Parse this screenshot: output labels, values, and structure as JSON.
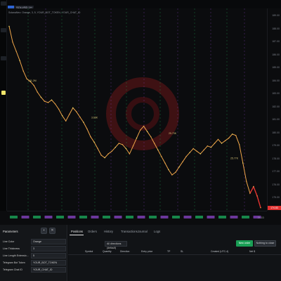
{
  "symbol": {
    "flag": "",
    "ticker": "SOLUSD 1H"
  },
  "indicator_label": "SolanaNeo: Orange, 3, 5, YOUR_BOT_TOKEN, YOUR_CHAT_ID",
  "colors": {
    "background": "#0b0c0e",
    "price_line": "#f0a64a",
    "drop_line": "#e0302f",
    "buy_green": "#1a9e55",
    "signal_purple": "#7c3fb4",
    "accent_yellow": "#f2e66b"
  },
  "price_axis": {
    "ticks": [
      "189.00",
      "188.00",
      "187.00",
      "186.00",
      "185.00",
      "184.00",
      "183.00",
      "182.00",
      "181.00",
      "180.00",
      "179.00",
      "178.00",
      "177.00",
      "176.00",
      "175.00"
    ],
    "last_price": "174.83"
  },
  "chart_annotations": [
    "101.2M",
    "3.66K",
    "25.73K",
    "25.77K"
  ],
  "params_panel": {
    "title": "Parameters",
    "rows": [
      {
        "label": "Line Color",
        "value": "Orange"
      },
      {
        "label": "Line Thickness",
        "value": "3"
      },
      {
        "label": "Line Length Extensio...",
        "value": "5"
      },
      {
        "label": "Telegram Bot Token",
        "value": "YOUR_BOT_TOKEN"
      },
      {
        "label": "Telegram Chat ID",
        "value": "YOUR_CHAT_ID"
      }
    ]
  },
  "bottom_panel": {
    "tabs": [
      "Positions",
      "Orders",
      "History",
      "Transactions",
      "Journal",
      "Logs"
    ],
    "filter": "All directions (default)",
    "new_order": "New order",
    "close_btn": "Nothing to close",
    "columns": [
      "Symbol",
      "Quantity",
      "Direction",
      "Entry price",
      "TP",
      "SL",
      "Created (UTC-4)",
      "Net $"
    ]
  },
  "controls": {
    "zoom": "2h 1D"
  },
  "chart_data": {
    "type": "line",
    "series": [
      {
        "values": [
          188.6,
          187.4,
          186.7,
          186.0,
          185.2,
          184.6,
          184.4,
          184.1,
          183.6,
          183.2,
          182.9,
          182.8,
          183.0,
          182.7,
          182.3,
          181.8,
          181.4,
          181.9,
          182.4,
          182.1,
          181.7,
          181.3,
          180.8,
          180.2,
          179.8,
          179.3,
          178.8,
          178.6,
          178.9,
          179.1,
          179.4,
          179.7,
          179.6,
          179.3,
          178.9,
          179.5,
          180.1,
          180.7,
          181.0,
          180.6,
          180.2,
          179.7,
          179.2,
          178.7,
          178.2,
          177.7,
          177.3,
          177.5,
          177.9,
          178.3,
          178.7,
          179.0,
          179.3,
          179.1,
          178.9,
          179.2,
          179.5,
          179.4,
          179.7,
          180.0,
          179.7,
          179.9,
          180.1,
          180.4,
          180.3,
          179.6,
          178.2,
          176.8,
          175.9,
          176.4,
          175.7,
          174.8
        ]
      }
    ],
    "ylim": [
      175.0,
      189.0
    ],
    "grid": false
  }
}
